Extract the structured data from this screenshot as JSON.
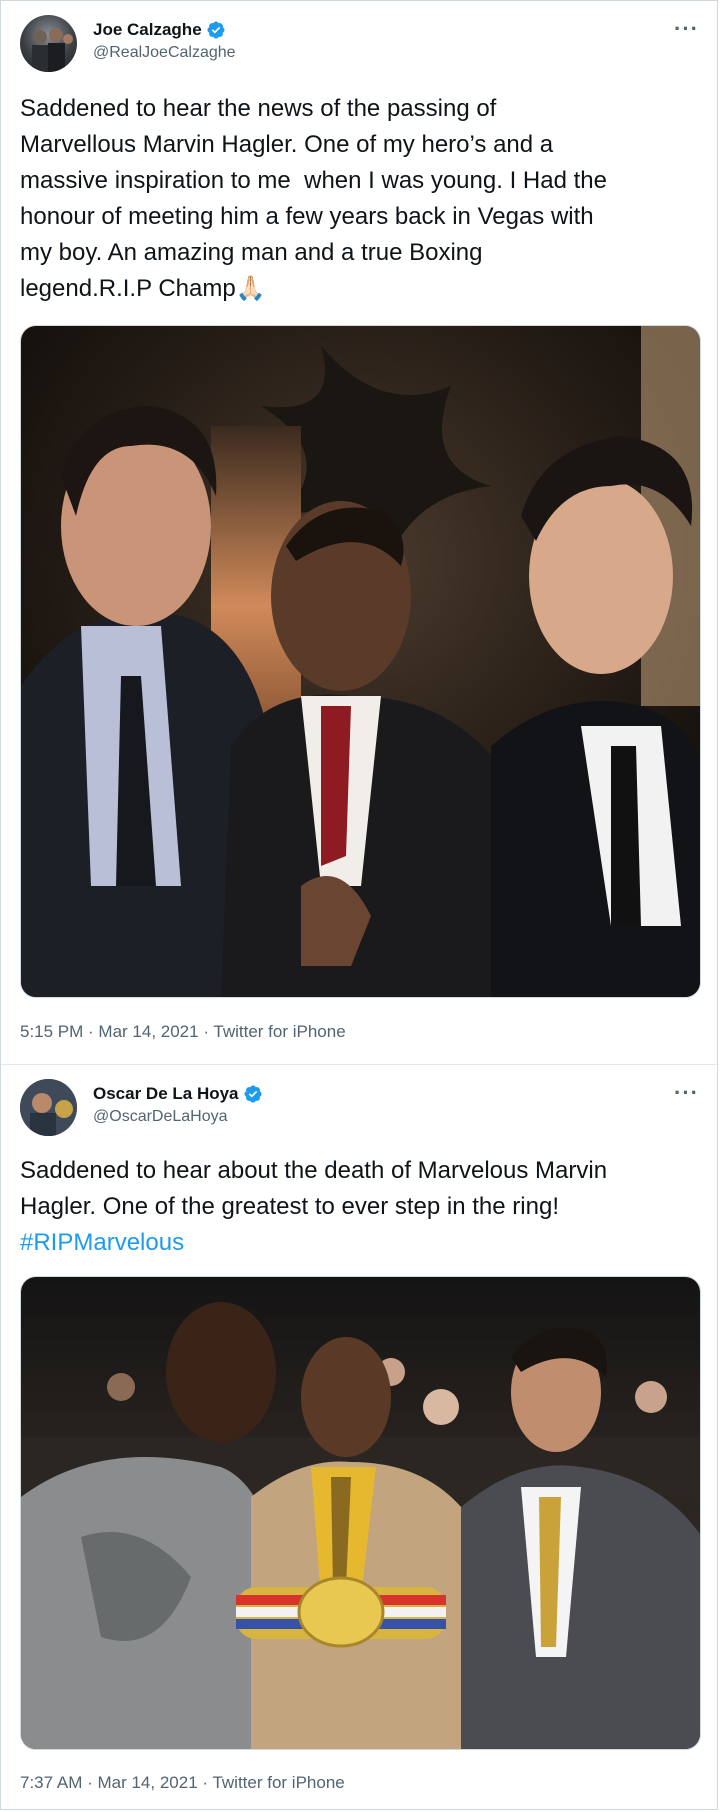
{
  "tweets": [
    {
      "display_name": "Joe Calzaghe",
      "handle": "@RealJoeCalzaghe",
      "text": "Saddened to hear the news of the passing of\nMarvellous Marvin Hagler. One of my hero’s and a\nmassive inspiration to me  when I was young. I Had the\nhonour of meeting him a few years back in Vegas with\nmy boy. An amazing man and a true Boxing\nlegend.R.I.P Champ🙏🏻",
      "timestamp": "5:15 PM · Mar 14, 2021 · Twitter for iPhone",
      "media": "photo-three-men-suits-night"
    },
    {
      "display_name": "Oscar De La Hoya",
      "handle": "@OscarDeLaHoya",
      "text": "Saddened to hear about the death of Marvelous Marvin\nHagler. One of the greatest to ever step in the ring!\n",
      "hashtag": "#RIPMarvelous",
      "timestamp": "7:37 AM · Mar 14, 2021 · Twitter for iPhone",
      "media": "photo-boxers-with-belt"
    }
  ],
  "icons": {
    "verified": "verified-badge-icon",
    "more": "more-options-icon"
  },
  "colors": {
    "accent": "#1d9bf0",
    "secondary_text": "#536471",
    "border": "#cfd9de"
  }
}
